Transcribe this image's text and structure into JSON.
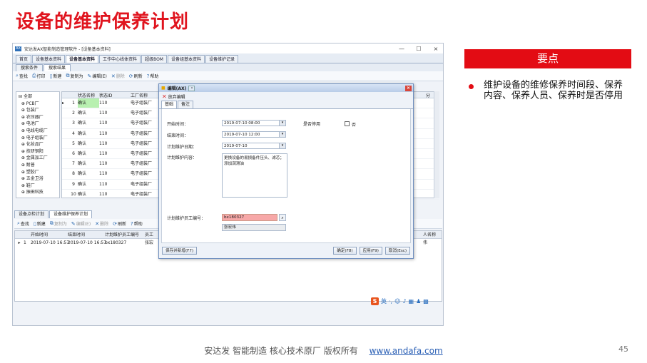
{
  "slide": {
    "title": "设备的维护保养计划",
    "key_header": "要点",
    "bullet": "维护设备的维修保养时间段、保养内容、保养人员、保养时是否停用",
    "footer_text": "安达发   智能制造 核心技术原厂   版权所有",
    "footer_url": "www.andafa.com",
    "page_number": "45"
  },
  "app": {
    "icon_text": "AX",
    "window_title": "安达发AX智能制造管理软件 - [设备基本资料]",
    "win_min": "—",
    "win_max": "☐",
    "win_close": "×",
    "tabs": [
      "首页",
      "设备基本资料",
      "设备基本资料",
      "工作中心线体资料",
      "超级BOM",
      "设备组基本资料",
      "设备维护记录"
    ],
    "active_tab_index": 2,
    "subtabs": [
      "搜索条件",
      "搜索结果"
    ],
    "toolbar": [
      "查找",
      "打印",
      "新建",
      "复制为",
      "编辑(E)",
      "删除",
      "刷新",
      "帮助"
    ],
    "tree_items": [
      "全部",
      "PCB厂",
      "包装厂",
      "农压器厂",
      "电池厂",
      "电线电缆厂",
      "电子组装厂",
      "化妆品厂",
      "技研钢阳",
      "金属加工厂",
      "耐普",
      "塑胶厂",
      "五金卫浴",
      "鞋厂",
      "振田科技"
    ],
    "grid1_headers": [
      "",
      "",
      "状态名称",
      "状态ID",
      "工厂名称"
    ],
    "grid1_rows": [
      {
        "n": "1",
        "status": "确认",
        "id": "110",
        "factory": "电子组装厂"
      },
      {
        "n": "2",
        "status": "确认",
        "id": "110",
        "factory": "电子组装厂"
      },
      {
        "n": "3",
        "status": "确认",
        "id": "110",
        "factory": "电子组装厂"
      },
      {
        "n": "4",
        "status": "确认",
        "id": "110",
        "factory": "电子组装厂"
      },
      {
        "n": "5",
        "status": "确认",
        "id": "110",
        "factory": "电子组装厂"
      },
      {
        "n": "6",
        "status": "确认",
        "id": "110",
        "factory": "电子组装厂"
      },
      {
        "n": "7",
        "status": "确认",
        "id": "110",
        "factory": "电子组装厂"
      },
      {
        "n": "8",
        "status": "确认",
        "id": "110",
        "factory": "电子组装厂"
      },
      {
        "n": "9",
        "status": "确认",
        "id": "110",
        "factory": "电子组装厂"
      },
      {
        "n": "10",
        "status": "确认",
        "id": "110",
        "factory": "电子组装厂"
      }
    ],
    "right_col_label": "分",
    "lower_tabs": [
      "设备点检计划",
      "设备维护保养计划"
    ],
    "toolbar2": [
      "查找",
      "新建",
      "复制为",
      "编辑(E)",
      "删除",
      "刷新",
      "帮助"
    ],
    "grid2_headers": [
      "开始时间",
      "结束时间",
      "计划维护员工编号",
      "员工"
    ],
    "grid2_right_header": "人名称",
    "grid2_row": {
      "n": "1",
      "start": "2019-07-10 16:57",
      "end": "2019-07-10 16:57",
      "emp": "bx180327",
      "name": "张宏"
    },
    "grid2_right_value": "伟",
    "ime_label": "英"
  },
  "dialog": {
    "title": "编辑(AX)",
    "discard": "放弃编辑",
    "tabs": [
      "基础",
      "备注"
    ],
    "start_label": "开始时间：",
    "start_value": "2019-07-10 08:00",
    "end_label": "结束时间：",
    "end_value": "2019-07-10 12:00",
    "date_label": "计划维护日期：",
    "date_value": "2019-07-10",
    "stop_label": "是否停用",
    "stop_value": "否",
    "content_label": "计划维护内容：",
    "content_value": "更换设备的易损备件压头、滤芯；添加润滑油",
    "emp_label": "计划维护员工编号：",
    "emp_value": "bx180327",
    "emp_name": "张宏伟",
    "btn_save_new": "保存并新增(F7)",
    "btn_ok": "确定(F8)",
    "btn_apply": "应用(F9)",
    "btn_cancel": "取消(Esc)"
  }
}
